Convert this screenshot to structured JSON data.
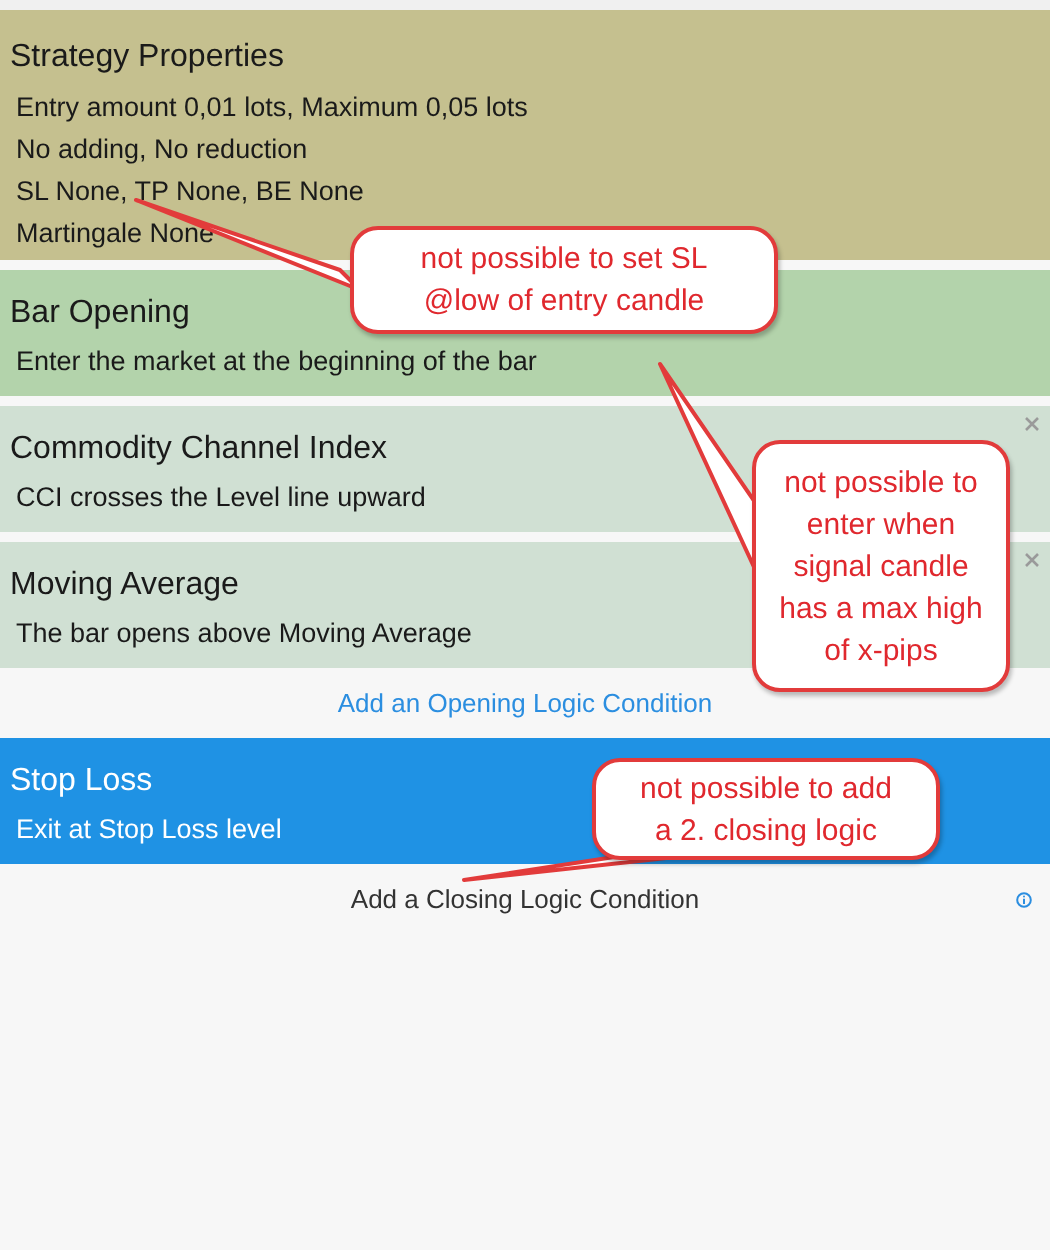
{
  "properties": {
    "title": "Strategy Properties",
    "lines": [
      "Entry amount 0,01 lots, Maximum 0,05 lots",
      "No adding, No reduction",
      "SL None,  TP None,  BE None",
      "Martingale None"
    ],
    "color": "#c5c08f"
  },
  "opening_conditions": {
    "items": [
      {
        "title": "Bar Opening",
        "line": "Enter the market at the beginning of the bar",
        "color": "#b3d3ab",
        "selected": false,
        "removable": false
      },
      {
        "title": "Commodity Channel Index",
        "line": "CCI crosses the Level line upward",
        "color": "#d0e0d3",
        "selected": false,
        "removable": true
      },
      {
        "title": "Moving Average",
        "line": "The bar opens above Moving Average",
        "color": "#d0e0d3",
        "selected": false,
        "removable": true
      }
    ],
    "add_link": "Add an Opening Logic Condition"
  },
  "closing_conditions": {
    "items": [
      {
        "title": "Stop Loss",
        "line": "Exit at Stop Loss level",
        "color": "#1f92e4",
        "selected": true,
        "removable": false
      }
    ],
    "add_link": "Add a Closing Logic Condition"
  },
  "callouts": [
    {
      "text": "not possible to set SL @low of entry candle"
    },
    {
      "text": "not possible to enter when signal candle has a max high of x-pips"
    },
    {
      "text": "not possible to add a 2. closing logic"
    }
  ]
}
